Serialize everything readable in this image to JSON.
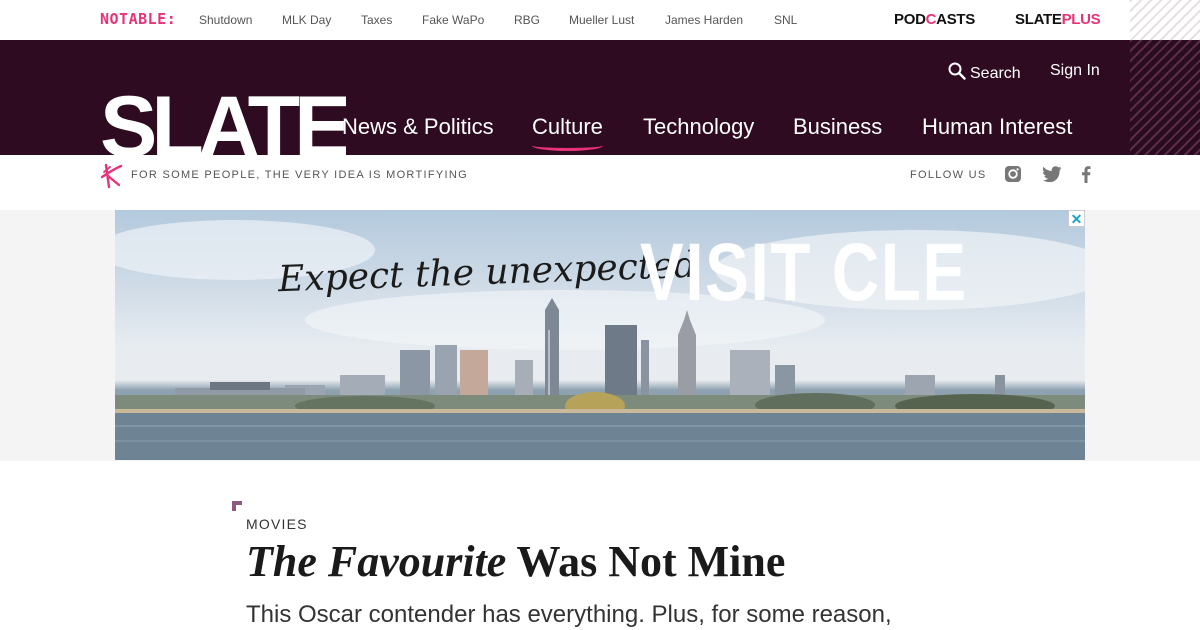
{
  "topbar": {
    "notable_label": "NOTABLE:",
    "trending": [
      "Shutdown",
      "MLK Day",
      "Taxes",
      "Fake WaPo",
      "RBG",
      "Mueller Lust",
      "James Harden",
      "SNL"
    ],
    "podcasts_prefix": "POD",
    "podcasts_suffix": "ASTS",
    "slate_label": "SLATE",
    "plus_label": "PLUS"
  },
  "header": {
    "search_label": "Search",
    "signin_label": "Sign In",
    "logo_text": "SLATE",
    "nav": [
      "News & Politics",
      "Culture",
      "Technology",
      "Business",
      "Human Interest"
    ],
    "active_nav": "Culture"
  },
  "tagline": {
    "text": "FOR SOME PEOPLE, THE VERY IDEA IS MORTIFYING",
    "follow_label": "FOLLOW US",
    "social_icons": [
      "instagram-icon",
      "twitter-icon",
      "facebook-icon"
    ]
  },
  "ad": {
    "slogan": "Expect the unexpected",
    "title": "VISIT CLE",
    "close_glyph": "✕"
  },
  "article": {
    "kicker": "MOVIES",
    "headline_italic": "The Favourite",
    "headline_rest": " Was Not Mine",
    "dek": "This Oscar contender has everything. Plus, for some reason,"
  },
  "colors": {
    "masthead": "#2e0b21",
    "accent": "#e8327a"
  }
}
